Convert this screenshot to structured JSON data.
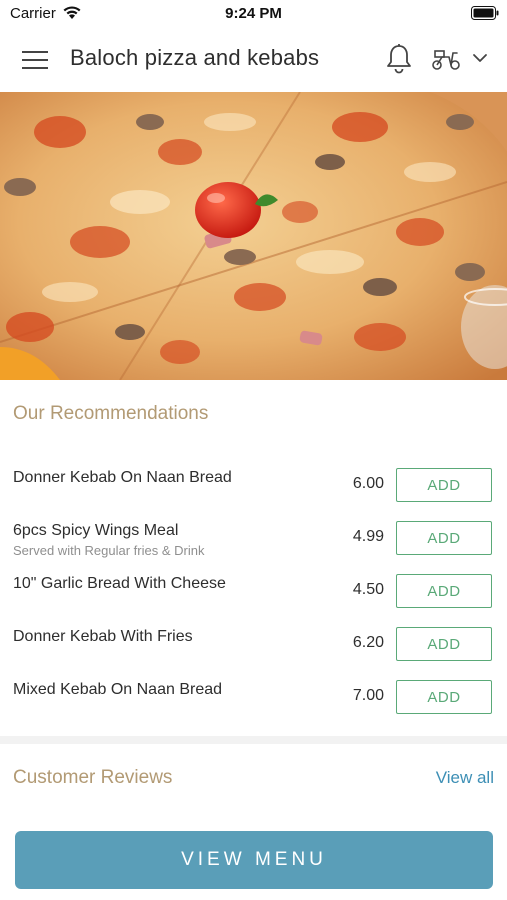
{
  "status_bar": {
    "carrier": "Carrier",
    "time": "9:24 PM"
  },
  "header": {
    "title": "Baloch pizza and kebabs",
    "icons": [
      "menu-icon",
      "bell-icon",
      "scooter-icon",
      "chevron-down-icon"
    ]
  },
  "hero": {
    "image": "pizza-photo"
  },
  "recommendations": {
    "title": "Our Recommendations",
    "add_label": "ADD",
    "items": [
      {
        "name": "Donner Kebab On Naan Bread",
        "description": "",
        "price": "6.00"
      },
      {
        "name": "6pcs Spicy Wings Meal",
        "description": "Served with Regular fries & Drink",
        "price": "4.99"
      },
      {
        "name": "10\" Garlic Bread With Cheese",
        "description": "",
        "price": "4.50"
      },
      {
        "name": "Donner Kebab With Fries",
        "description": "",
        "price": "6.20"
      },
      {
        "name": "Mixed Kebab On Naan Bread",
        "description": "",
        "price": "7.00"
      }
    ]
  },
  "reviews": {
    "title": "Customer Reviews",
    "view_all_label": "View all"
  },
  "cta": {
    "view_menu_label": "VIEW MENU"
  },
  "colors": {
    "accent_green": "#5aa978",
    "section_title": "#b29a74",
    "link_blue": "#3d8fb5",
    "cta_blue": "#5a9eb8"
  }
}
